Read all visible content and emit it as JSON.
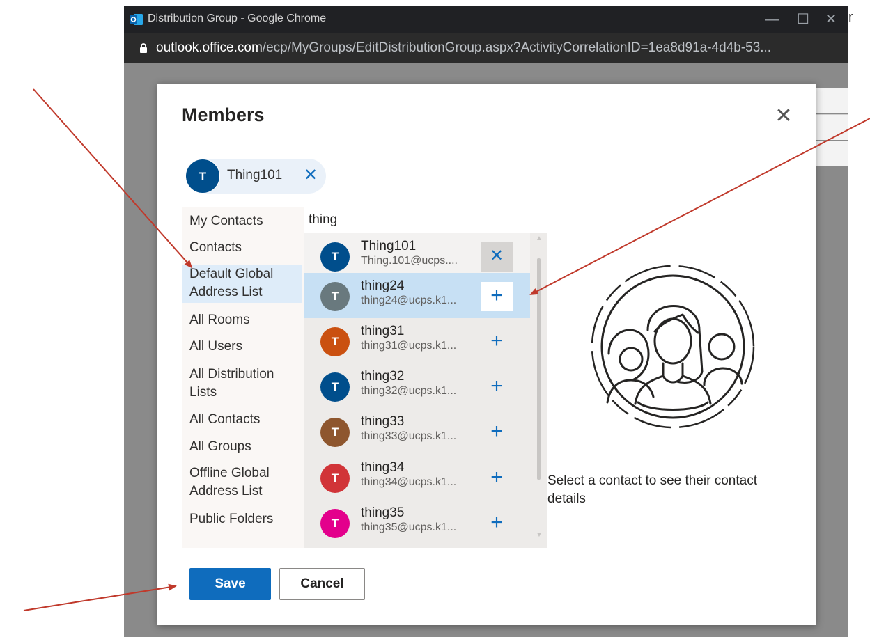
{
  "browser": {
    "window_title": "Distribution Group - Google Chrome",
    "url_domain": "outlook.office.com",
    "url_path": "/ecp/MyGroups/EditDistributionGroup.aspx?ActivityCorrelationID=1ea8d91a-4d4b-53...",
    "outside_text": "r"
  },
  "dialog": {
    "title": "Members",
    "close_glyph": "✕"
  },
  "selected_chip": {
    "initial": "T",
    "name": "Thing101",
    "remove_glyph": "✕"
  },
  "directories": [
    {
      "label": "My Contacts",
      "selected": false
    },
    {
      "label": "Contacts",
      "selected": false
    },
    {
      "label": "Default Global Address List",
      "selected": true
    },
    {
      "label": "All Rooms",
      "selected": false
    },
    {
      "label": "All Users",
      "selected": false
    },
    {
      "label": "All Distribution Lists",
      "selected": false
    },
    {
      "label": "All Contacts",
      "selected": false
    },
    {
      "label": "All Groups",
      "selected": false
    },
    {
      "label": "Offline Global Address List",
      "selected": false
    },
    {
      "label": "Public Folders",
      "selected": false
    }
  ],
  "search": {
    "value": "thing"
  },
  "results": [
    {
      "initial": "T",
      "name": "Thing101",
      "email": "Thing.101@ucps....",
      "color": "#004e8c",
      "action": "✕",
      "state": "added"
    },
    {
      "initial": "T",
      "name": "thing24",
      "email": "thing24@ucps.k1...",
      "color": "#69797e",
      "action": "+",
      "state": "selected"
    },
    {
      "initial": "T",
      "name": "thing31",
      "email": "thing31@ucps.k1...",
      "color": "#ca5010",
      "action": "+",
      "state": "normal"
    },
    {
      "initial": "T",
      "name": "thing32",
      "email": "thing32@ucps.k1...",
      "color": "#004e8c",
      "action": "+",
      "state": "normal"
    },
    {
      "initial": "T",
      "name": "thing33",
      "email": "thing33@ucps.k1...",
      "color": "#8e562e",
      "action": "+",
      "state": "normal"
    },
    {
      "initial": "T",
      "name": "thing34",
      "email": "thing34@ucps.k1...",
      "color": "#d13438",
      "action": "+",
      "state": "normal"
    },
    {
      "initial": "T",
      "name": "thing35",
      "email": "thing35@ucps.k1...",
      "color": "#e3008c",
      "action": "+",
      "state": "normal"
    }
  ],
  "details_placeholder": "Select a contact to see their contact details",
  "buttons": {
    "save": "Save",
    "cancel": "Cancel"
  },
  "colors": {
    "accent": "#0f6cbd",
    "annotation_arrow": "#c0392b"
  }
}
